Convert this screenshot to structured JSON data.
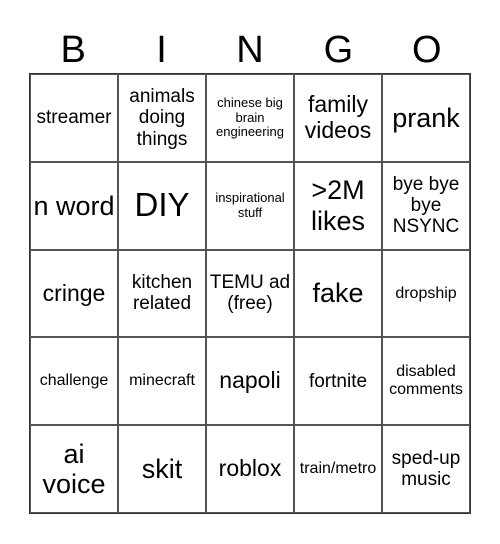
{
  "header": {
    "letters": [
      "B",
      "I",
      "N",
      "G",
      "O"
    ]
  },
  "grid": {
    "rows": [
      [
        {
          "text": "streamer",
          "size": "s-md"
        },
        {
          "text": "animals doing things",
          "size": "s-md"
        },
        {
          "text": "chinese big brain engineering",
          "size": "s-xs"
        },
        {
          "text": "family videos",
          "size": "s-lg"
        },
        {
          "text": "prank",
          "size": "s-xl"
        }
      ],
      [
        {
          "text": "n word",
          "size": "s-xl"
        },
        {
          "text": "DIY",
          "size": "s-xxl"
        },
        {
          "text": "inspirational stuff",
          "size": "s-xs"
        },
        {
          "text": ">2M likes",
          "size": "s-xl"
        },
        {
          "text": "bye bye bye NSYNC",
          "size": "s-md"
        }
      ],
      [
        {
          "text": "cringe",
          "size": "s-lg"
        },
        {
          "text": "kitchen related",
          "size": "s-md"
        },
        {
          "text": "TEMU ad (free)",
          "size": "s-md"
        },
        {
          "text": "fake",
          "size": "s-xl"
        },
        {
          "text": "dropship",
          "size": "s-sm"
        }
      ],
      [
        {
          "text": "challenge",
          "size": "s-sm"
        },
        {
          "text": "minecraft",
          "size": "s-sm"
        },
        {
          "text": "napoli",
          "size": "s-lg"
        },
        {
          "text": "fortnite",
          "size": "s-md"
        },
        {
          "text": "disabled comments",
          "size": "s-sm"
        }
      ],
      [
        {
          "text": "ai voice",
          "size": "s-xl"
        },
        {
          "text": "skit",
          "size": "s-xl"
        },
        {
          "text": "roblox",
          "size": "s-lg"
        },
        {
          "text": "train/metro",
          "size": "s-sm"
        },
        {
          "text": "sped-up music",
          "size": "s-md"
        }
      ]
    ]
  }
}
